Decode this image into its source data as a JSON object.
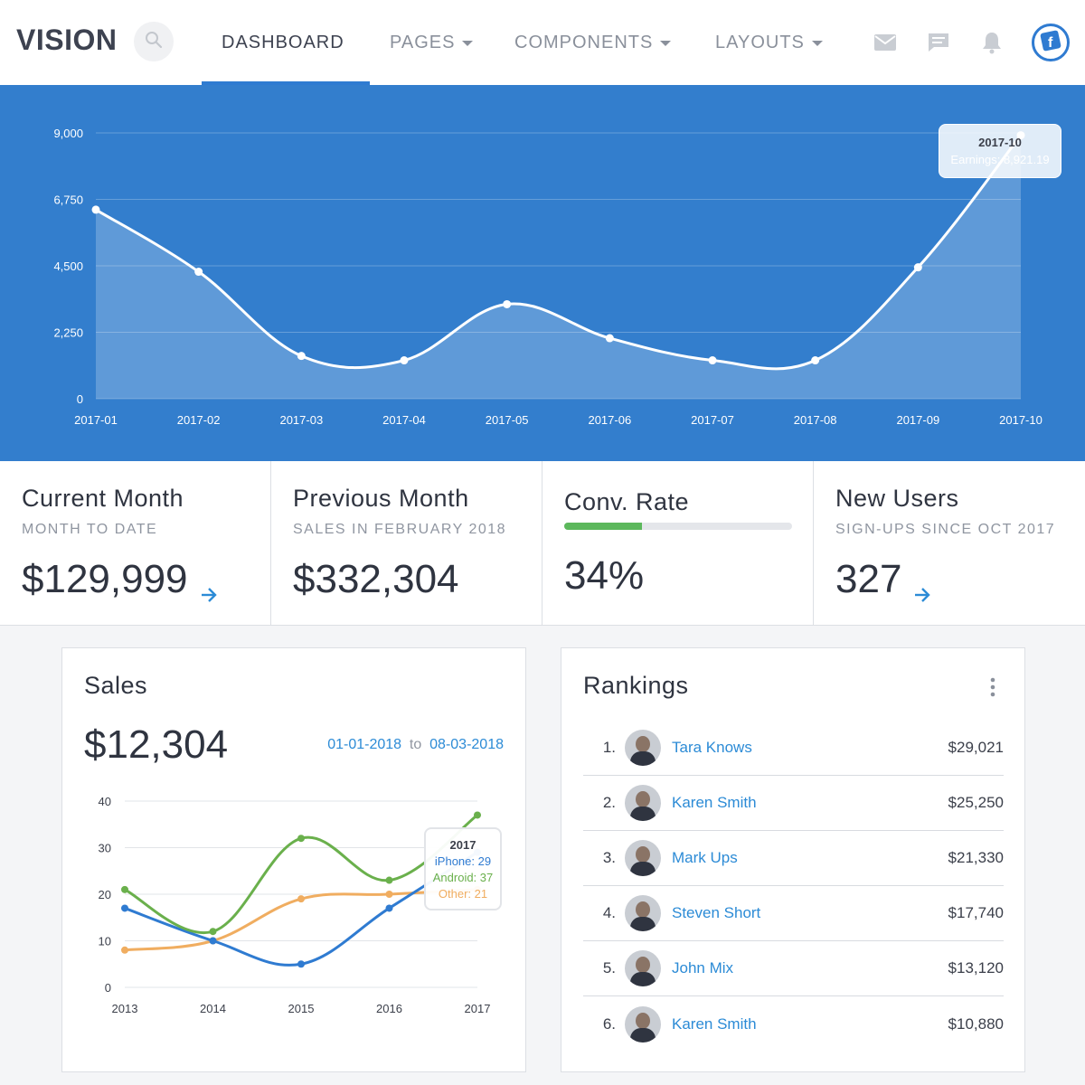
{
  "nav": {
    "brand": "VISION",
    "items": [
      {
        "label": "DASHBOARD"
      },
      {
        "label": "PAGES"
      },
      {
        "label": "COMPONENTS"
      },
      {
        "label": "LAYOUTS"
      }
    ],
    "icons": [
      "search-icon",
      "mail-icon",
      "chat-icon",
      "bell-icon",
      "facebook-icon"
    ]
  },
  "earnings_tooltip": {
    "title": "2017-10",
    "label": "Earnings: 8,921.19"
  },
  "stats": [
    {
      "title": "Current Month",
      "sub": "MONTH TO DATE",
      "value": "$129,999"
    },
    {
      "title": "Previous Month",
      "sub": "SALES IN FEBRUARY 2018",
      "value": "$332,304"
    },
    {
      "title": "Conv. Rate",
      "value": "34%",
      "progress": 0.34
    },
    {
      "title": "New Users",
      "sub": "SIGN-UPS SINCE OCT 2017",
      "value": "327"
    }
  ],
  "sales": {
    "title": "Sales",
    "amount": "$12,304",
    "date_from": "01-01-2018",
    "date_sep": "to",
    "date_to": "08-03-2018",
    "tooltip": {
      "title": "2017",
      "iphone": "iPhone: 29",
      "android": "Android: 37",
      "other": "Other: 21"
    }
  },
  "rankings": {
    "title": "Rankings",
    "rows": [
      {
        "rank": "1.",
        "name": "Tara Knows",
        "amount": "$29,021"
      },
      {
        "rank": "2.",
        "name": "Karen Smith",
        "amount": "$25,250"
      },
      {
        "rank": "3.",
        "name": "Mark Ups",
        "amount": "$21,330"
      },
      {
        "rank": "4.",
        "name": "Steven Short",
        "amount": "$17,740"
      },
      {
        "rank": "5.",
        "name": "John Mix",
        "amount": "$13,120"
      },
      {
        "rank": "6.",
        "name": "Karen Smith",
        "amount": "$10,880"
      }
    ]
  },
  "colors": {
    "primary": "#337ecd",
    "accent": "#2c8bd6",
    "green": "#5cb85c",
    "orange": "#f0ad60",
    "blue_series": "#2f7bd1",
    "green_series": "#6ab04c"
  },
  "chart_data": [
    {
      "type": "area",
      "categories": [
        "2017-01",
        "2017-02",
        "2017-03",
        "2017-04",
        "2017-05",
        "2017-06",
        "2017-07",
        "2017-08",
        "2017-09",
        "2017-10"
      ],
      "series": [
        {
          "name": "Earnings",
          "values": [
            6400,
            4300,
            1450,
            1300,
            3200,
            2050,
            1300,
            1300,
            4450,
            8921.19
          ]
        }
      ],
      "yticks": [
        "0",
        "2,250",
        "4,500",
        "6,750",
        "9,000"
      ],
      "ylim": [
        0,
        9000
      ],
      "grid": true
    },
    {
      "type": "line",
      "categories": [
        "2013",
        "2014",
        "2015",
        "2016",
        "2017"
      ],
      "series": [
        {
          "name": "iPhone",
          "values": [
            17,
            10,
            5,
            17,
            29
          ]
        },
        {
          "name": "Android",
          "values": [
            21,
            12,
            32,
            23,
            37
          ]
        },
        {
          "name": "Other",
          "values": [
            8,
            10,
            19,
            20,
            21
          ]
        }
      ],
      "yticks": [
        "0",
        "10",
        "20",
        "30",
        "40"
      ],
      "ylim": [
        0,
        40
      ],
      "grid": true
    }
  ]
}
